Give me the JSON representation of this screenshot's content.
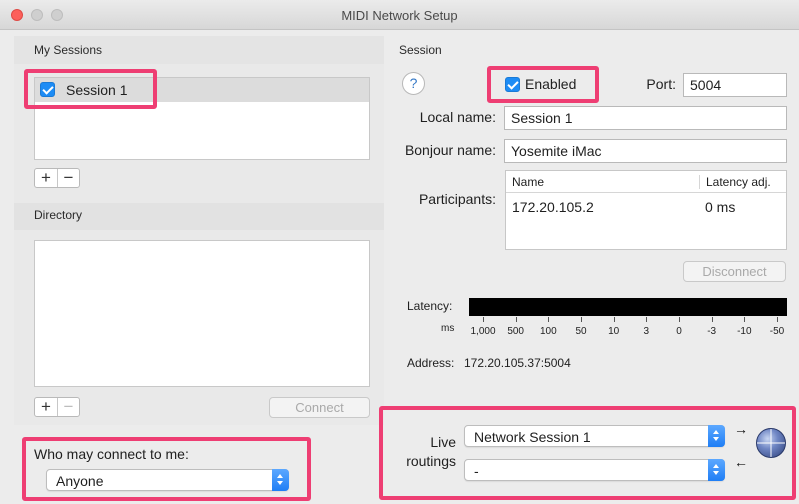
{
  "window": {
    "title": "MIDI Network Setup"
  },
  "left": {
    "my_sessions_label": "My Sessions",
    "sessions": [
      {
        "name": "Session 1",
        "checked": true
      }
    ],
    "add_symbol": "+",
    "remove_symbol": "−",
    "directory_label": "Directory",
    "connect_label": "Connect",
    "who_may_connect_label": "Who may connect to me:",
    "who_may_connect_value": "Anyone"
  },
  "session": {
    "section_label": "Session",
    "help_symbol": "?",
    "enabled_label": "Enabled",
    "enabled": true,
    "port_label": "Port:",
    "port_value": "5004",
    "local_name_label": "Local name:",
    "local_name_value": "Session 1",
    "bonjour_name_label": "Bonjour name:",
    "bonjour_name_value": "Yosemite iMac",
    "participants_label": "Participants:",
    "participants_columns": {
      "name": "Name",
      "latency": "Latency adj."
    },
    "participants": [
      {
        "name": "172.20.105.2",
        "latency": "0 ms"
      }
    ],
    "disconnect_label": "Disconnect",
    "latency_label": "Latency:",
    "latency_unit": "ms",
    "latency_ticks": [
      "1,000",
      "500",
      "100",
      "50",
      "10",
      "3",
      "0",
      "-3",
      "-10",
      "-50"
    ],
    "address_label": "Address:",
    "address_value": "172.20.105.37:5004",
    "live_routings_label_1": "Live",
    "live_routings_label_2": "routings",
    "routing_out": "Network Session 1",
    "routing_in": "-",
    "arrow_out": "→",
    "arrow_in": "←"
  },
  "colors": {
    "highlight": "#ee3e73",
    "accent": "#1d8cf5",
    "close": "#fc605b"
  },
  "icons": [
    "help-icon",
    "globe-icon",
    "checkbox-checked-icon",
    "popup-arrows-icon"
  ]
}
